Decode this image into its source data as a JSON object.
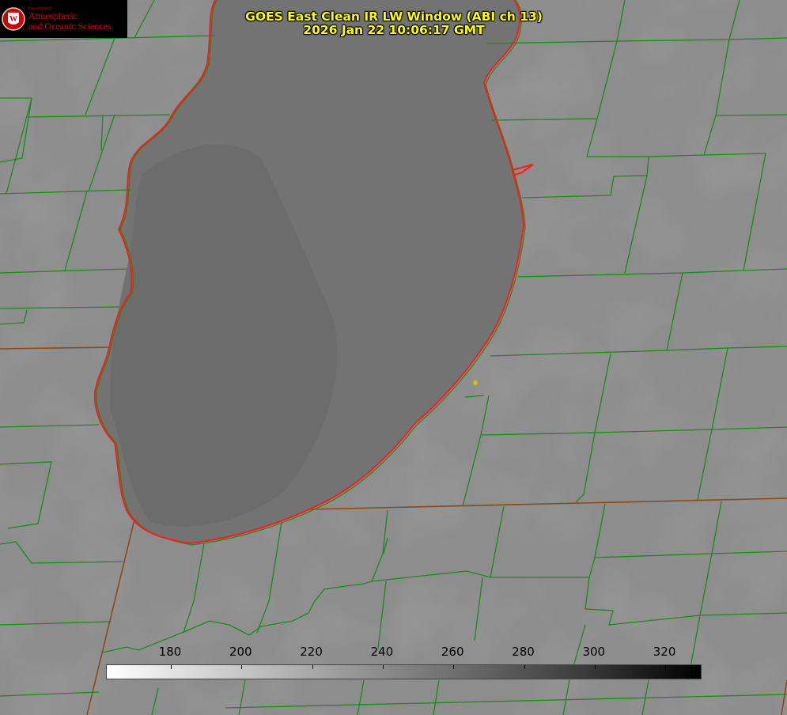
{
  "title": {
    "line1": "GOES East Clean IR LW Window (ABI ch 13)",
    "line2": "2026 Jan 22 10:06:17 GMT"
  },
  "logo": {
    "small_text": "Department of",
    "name_line1": "Atmospheric",
    "name_line2": "and Oceanic Sciences",
    "seal_letter": "W"
  },
  "colorbar": {
    "ticks": [
      "180",
      "200",
      "220",
      "240",
      "260",
      "280",
      "300",
      "320"
    ],
    "gradient": [
      "#ffffff",
      "#9a9a9a",
      "#3c3c3c",
      "#000000"
    ]
  },
  "colors": {
    "land": "#8d8d8d",
    "lake": "#6f6f6f",
    "county_lines": "#1b8a1b",
    "state_lines": "#8a4a1b",
    "coastline": "#ff1a1a",
    "title": "#ffff00",
    "station_marker": "#d4c400"
  }
}
